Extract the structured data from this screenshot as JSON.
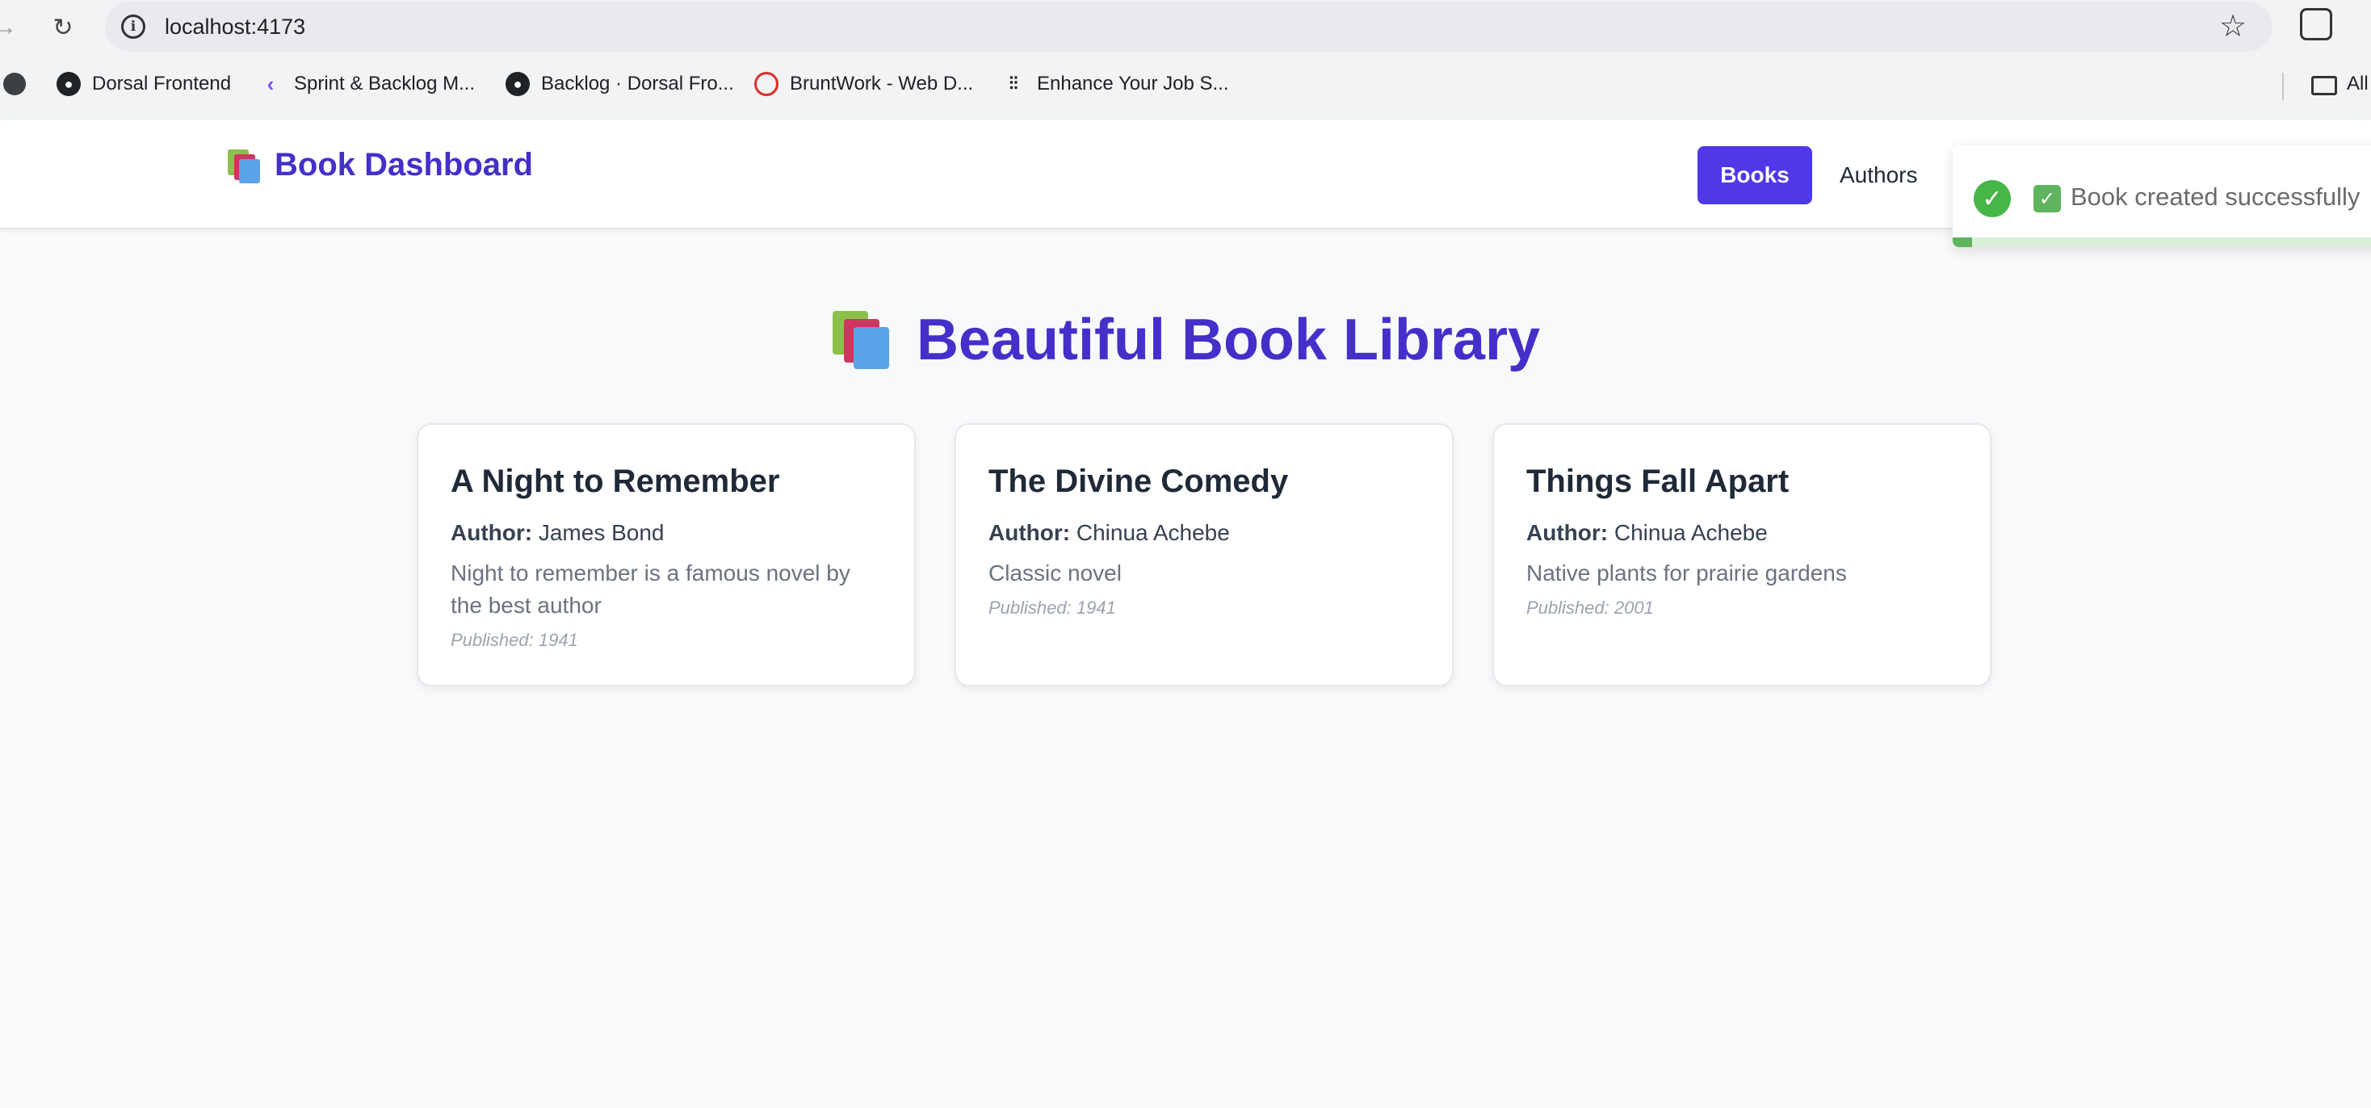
{
  "browser": {
    "url": "localhost:4173",
    "bookmarks": [
      {
        "label": "Dorsal Frontend"
      },
      {
        "label": "Sprint & Backlog M..."
      },
      {
        "label": "Backlog · Dorsal Fro..."
      },
      {
        "label": "BruntWork - Web D..."
      },
      {
        "label": "Enhance Your Job S..."
      }
    ],
    "all_bookmarks_label": "All"
  },
  "header": {
    "brand_icon": "books-icon",
    "brand_title": "Book Dashboard",
    "nav": [
      {
        "label": "Books",
        "active": true
      },
      {
        "label": "Authors",
        "active": false
      }
    ],
    "accent_color": "#4f38e8"
  },
  "toast": {
    "message": "Book created successfully",
    "status_color": "#47b649",
    "progress": 0.045
  },
  "main": {
    "title": "Beautiful Book Library",
    "author_label": "Author:",
    "books": [
      {
        "title": "A Night to Remember",
        "author": "James Bond",
        "description": "Night to remember is a famous novel by the best author",
        "published": "Published: 1941"
      },
      {
        "title": "The Divine Comedy",
        "author": "Chinua Achebe",
        "description": "Classic novel",
        "published": "Published: 1941"
      },
      {
        "title": "Things Fall Apart",
        "author": "Chinua Achebe",
        "description": "Native plants for prairie gardens",
        "published": "Published: 2001"
      }
    ]
  }
}
